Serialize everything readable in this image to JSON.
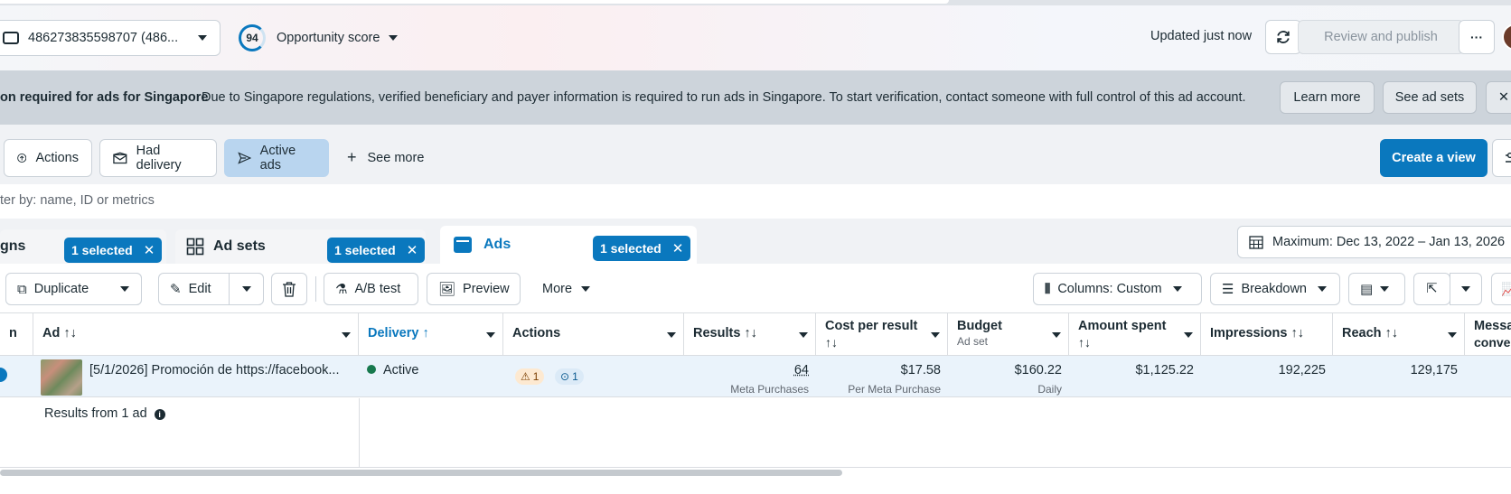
{
  "header": {
    "account_label": "486273835598707 (486...",
    "opportunity_score": "94",
    "opportunity_label": "Opportunity score",
    "updated_text": "Updated just now",
    "review_label": "Review and publish",
    "more_label": "···"
  },
  "banner": {
    "title": "on required for ads for Singapore",
    "message": "Due to Singapore regulations, verified beneficiary and payer information is required to run ads in Singapore. To start verification, contact someone with full control of this ad account.",
    "learn_more": "Learn more",
    "see_ad_sets": "See ad sets",
    "close": "✕"
  },
  "chips": {
    "actions": "Actions",
    "had_delivery": "Had delivery",
    "active_ads": "Active ads",
    "see_more": "See more",
    "create_view": "Create a view"
  },
  "filter": {
    "placeholder": "ter by: name, ID or metrics"
  },
  "level_tabs": {
    "campaigns": "gns",
    "ad_sets": "Ad sets",
    "ads": "Ads",
    "selected": "1 selected",
    "date_range": "Maximum: Dec 13, 2022 – Jan 13, 2026"
  },
  "toolbar": {
    "duplicate": "Duplicate",
    "edit": "Edit",
    "ab_test": "A/B test",
    "preview": "Preview",
    "more": "More",
    "columns": "Columns: Custom",
    "breakdown": "Breakdown"
  },
  "table": {
    "headers": {
      "col0": "n",
      "ad": "Ad ↑↓",
      "delivery": "Delivery ↑",
      "actions": "Actions",
      "results": "Results ↑↓",
      "cost_per_result": "Cost per result",
      "cost_sort": "↑↓",
      "budget": "Budget",
      "budget_sub": "Ad set",
      "amount_spent": "Amount spent",
      "amount_sort": "↑↓",
      "impressions": "Impressions ↑↓",
      "reach": "Reach ↑↓",
      "messaging_1": "Messa",
      "messaging_2": "conve"
    },
    "row": {
      "ad_name": "[5/1/2026] Promoción de https://facebook...",
      "delivery": "Active",
      "warn_badge": "1",
      "info_badge": "1",
      "results": "64",
      "results_sub": "Meta Purchases",
      "cost": "$17.58",
      "cost_sub": "Per Meta Purchase",
      "budget": "$160.22",
      "budget_sub": "Daily",
      "amount": "$1,125.22",
      "impressions": "192,225",
      "reach": "129,175"
    },
    "footer": "Results from 1 ad"
  }
}
